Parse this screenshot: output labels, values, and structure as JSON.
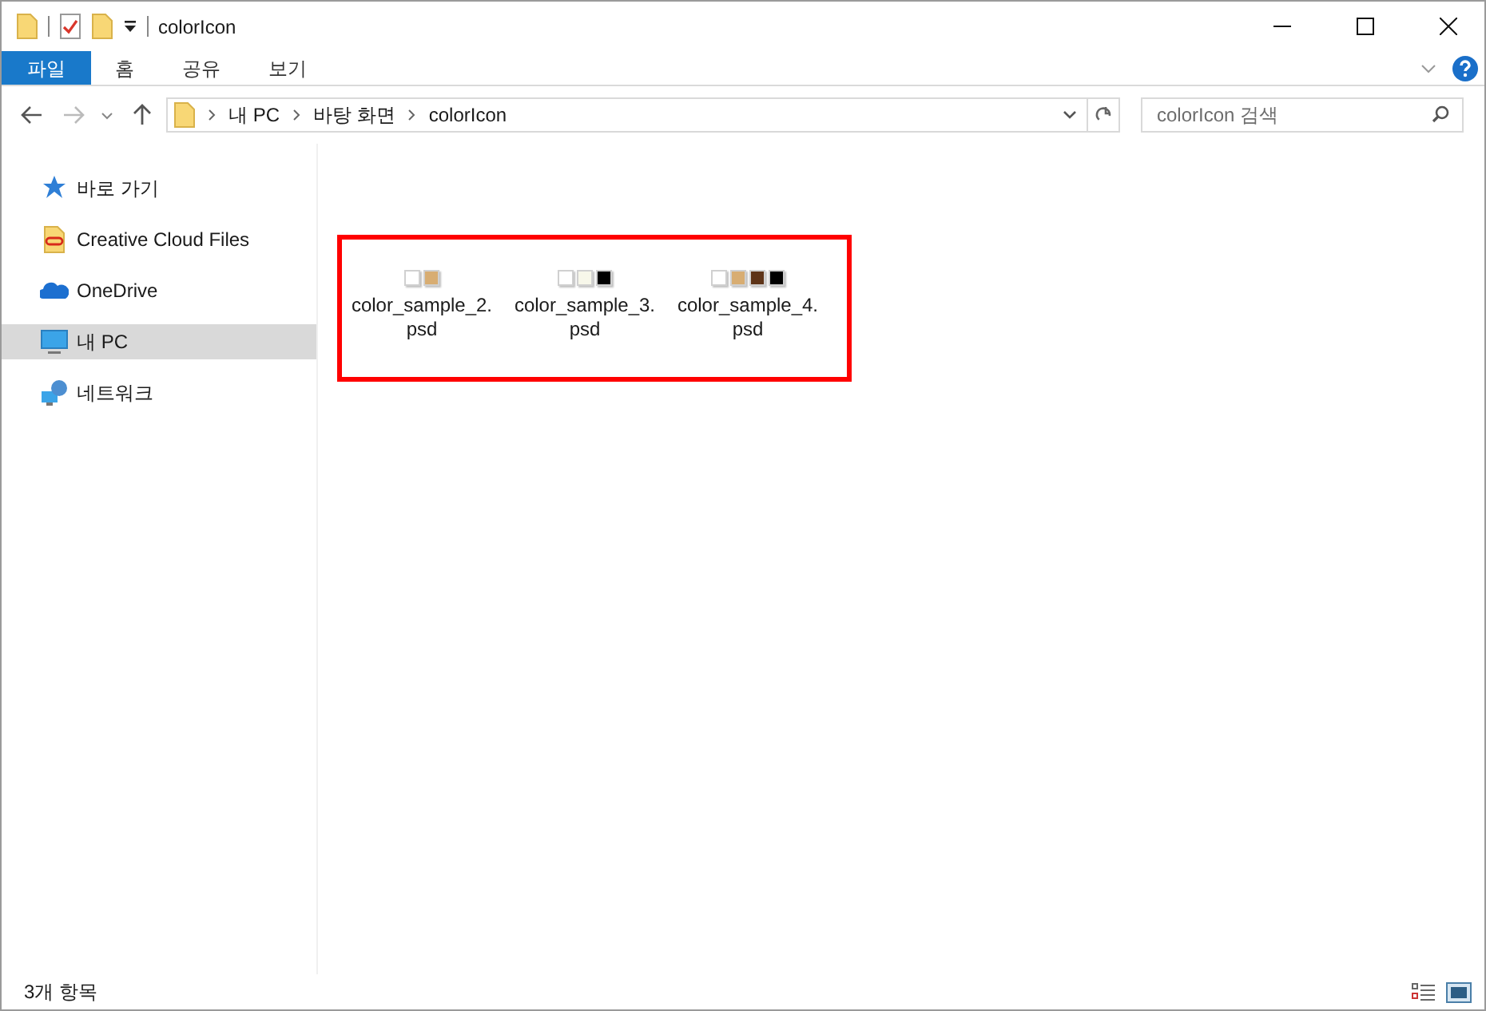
{
  "window": {
    "title": "colorIcon"
  },
  "ribbon_tabs": [
    {
      "label": "파일",
      "selected": true
    },
    {
      "label": "홈",
      "selected": false
    },
    {
      "label": "공유",
      "selected": false
    },
    {
      "label": "보기",
      "selected": false
    }
  ],
  "address": {
    "path": [
      "내 PC",
      "바탕 화면",
      "colorIcon"
    ]
  },
  "search": {
    "placeholder": "colorIcon 검색"
  },
  "sidebar": {
    "items": [
      {
        "label": "바로 가기",
        "kind": "star",
        "selected": false
      },
      {
        "label": "Creative Cloud Files",
        "kind": "cloudfolder",
        "selected": false
      },
      {
        "label": "OneDrive",
        "kind": "cloud",
        "selected": false
      },
      {
        "label": "내 PC",
        "kind": "pc",
        "selected": true
      },
      {
        "label": "네트워크",
        "kind": "network",
        "selected": false
      }
    ]
  },
  "files": [
    {
      "name": "color_sample_2.psd",
      "swatches": [
        {
          "color": "#ffffff"
        },
        {
          "color": "#d8ad72"
        }
      ]
    },
    {
      "name": "color_sample_3.psd",
      "swatches": [
        {
          "color": "#ffffff"
        },
        {
          "color": "#f7f7ea"
        },
        {
          "color": "#000000"
        }
      ]
    },
    {
      "name": "color_sample_4.psd",
      "swatches": [
        {
          "color": "#ffffff"
        },
        {
          "color": "#d8ad72"
        },
        {
          "color": "#5e3418"
        },
        {
          "color": "#000000"
        }
      ]
    }
  ],
  "status_bar": {
    "count": "3개 항목"
  }
}
